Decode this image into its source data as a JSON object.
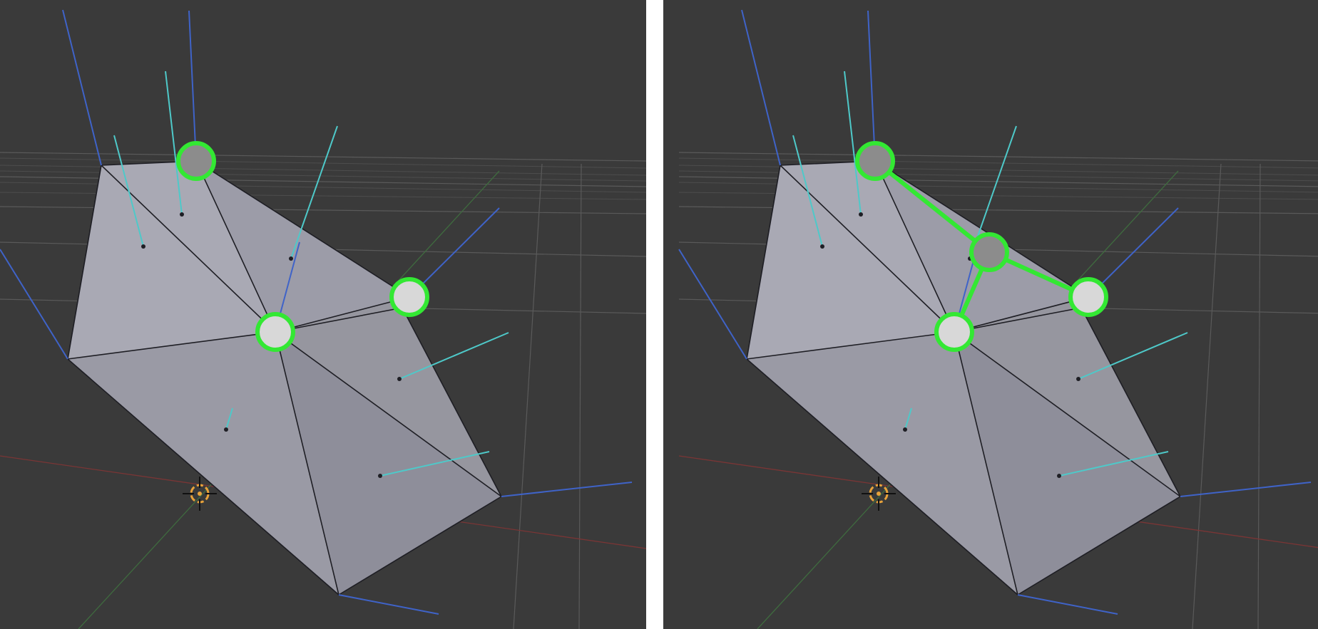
{
  "viewports": [
    {
      "id": "left",
      "selected_vertex_count": 3,
      "new_vertex_added": false
    },
    {
      "id": "right",
      "selected_vertex_count": 4,
      "new_vertex_added": true
    }
  ],
  "colors": {
    "background": "#3a3a3a",
    "mesh_face": "#9a9aa6",
    "mesh_edge": "#1e1e24",
    "grid_line": "#5a5a5a",
    "face_normal": "#4ec9c9",
    "vertex_normal": "#3f63c8",
    "selection_green": "#33e833",
    "x_axis": "#7a3535",
    "y_axis": "#3f6b3f",
    "cursor_orange": "#e8a23a"
  },
  "icons": [
    "3d-cursor-icon"
  ]
}
